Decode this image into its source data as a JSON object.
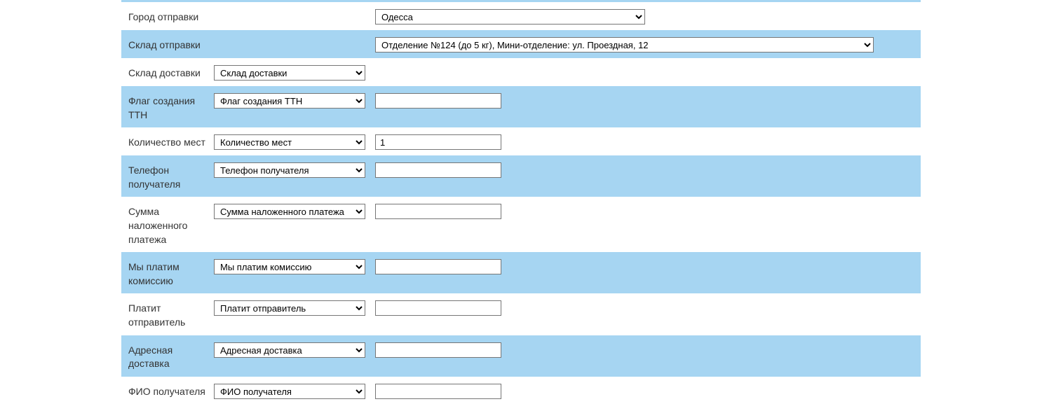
{
  "rows": {
    "shipCity": {
      "label": "Город отправки",
      "select": "Одесса"
    },
    "shipWarehouse": {
      "label": "Склад отправки",
      "select": "Отделение №124 (до 5 кг), Мини-отделение: ул. Проездная, 12"
    },
    "deliveryWarehouse": {
      "label": "Склад доставки",
      "select": "Склад доставки"
    },
    "ttnFlag": {
      "label": "Флаг создания ТТН",
      "select": "Флаг создания ТТН",
      "input": ""
    },
    "placesCount": {
      "label": "Количество мест",
      "select": "Количество мест",
      "input": "1"
    },
    "receiverPhone": {
      "label": "Телефон получателя",
      "select": "Телефон получателя",
      "input": ""
    },
    "codAmount": {
      "label": "Сумма наложенного платежа",
      "select": "Сумма наложенного платежа",
      "input": ""
    },
    "wePayCommission": {
      "label": "Мы платим комиссию",
      "select": "Мы платим комиссию",
      "input": ""
    },
    "senderPays": {
      "label": "Платит отправитель",
      "select": "Платит отправитель",
      "input": ""
    },
    "addressDelivery": {
      "label": "Адресная доставка",
      "select": "Адресная доставка",
      "input": ""
    },
    "receiverName": {
      "label": "ФИО получателя",
      "select": "ФИО получателя",
      "input": ""
    }
  }
}
